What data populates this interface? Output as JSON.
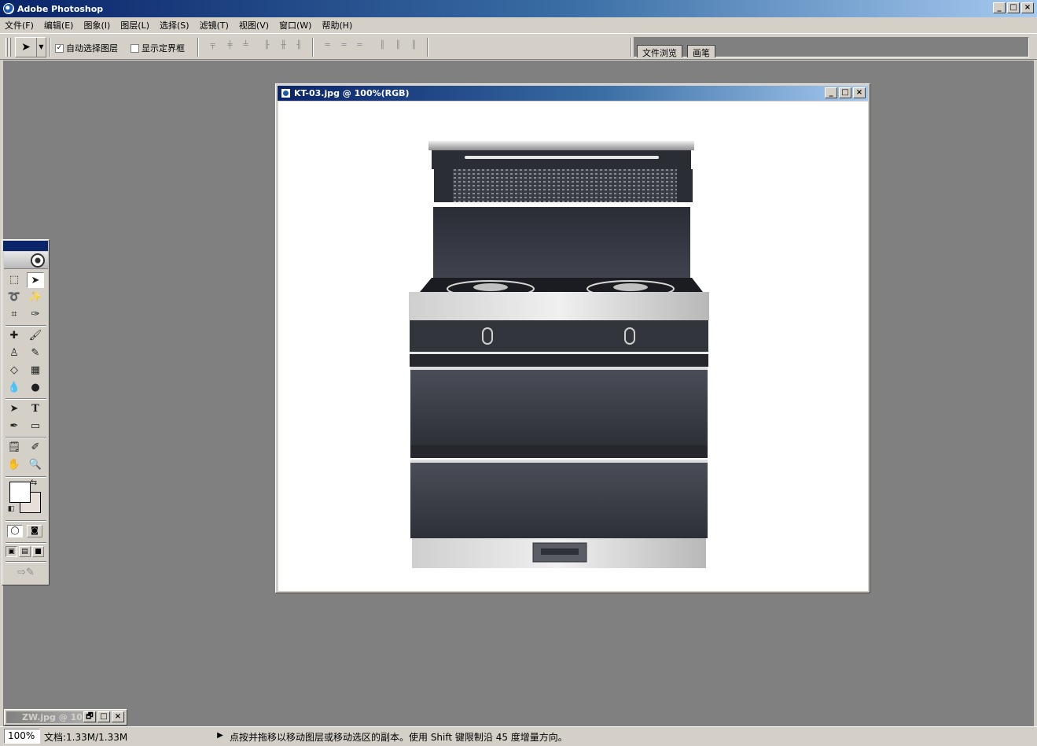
{
  "app": {
    "title": "Adobe Photoshop",
    "window_buttons": [
      "_",
      "□",
      "×"
    ]
  },
  "menu": [
    "文件(F)",
    "编辑(E)",
    "图象(I)",
    "图层(L)",
    "选择(S)",
    "滤镜(T)",
    "视图(V)",
    "窗口(W)",
    "帮助(H)"
  ],
  "options": {
    "tool_icon": "move-tool-icon",
    "auto_select_label": "自动选择图层",
    "auto_select_checked": "✓",
    "show_bounds_label": "显示定界框",
    "show_bounds_checked": ""
  },
  "palette_well": {
    "tabs": [
      "文件浏览",
      "画笔"
    ]
  },
  "document": {
    "title": "KT-03.jpg @ 100%(RGB)",
    "window_buttons": [
      "_",
      "□",
      "×"
    ]
  },
  "minimized_doc": {
    "title": "ZW.jpg @ 10...",
    "window_buttons": [
      "🗗",
      "□",
      "×"
    ]
  },
  "colors": {
    "foreground": "#ffffff",
    "background": "#e8e0d8",
    "titlebar_start": "#0a246a",
    "titlebar_end": "#a6caf0",
    "workspace": "#808080"
  },
  "status": {
    "zoom": "100%",
    "doc_size": "文档:1.33M/1.33M",
    "message": "点按并拖移以移动图层或移动选区的副本。使用 Shift 键限制沿 45 度增量方向。"
  }
}
